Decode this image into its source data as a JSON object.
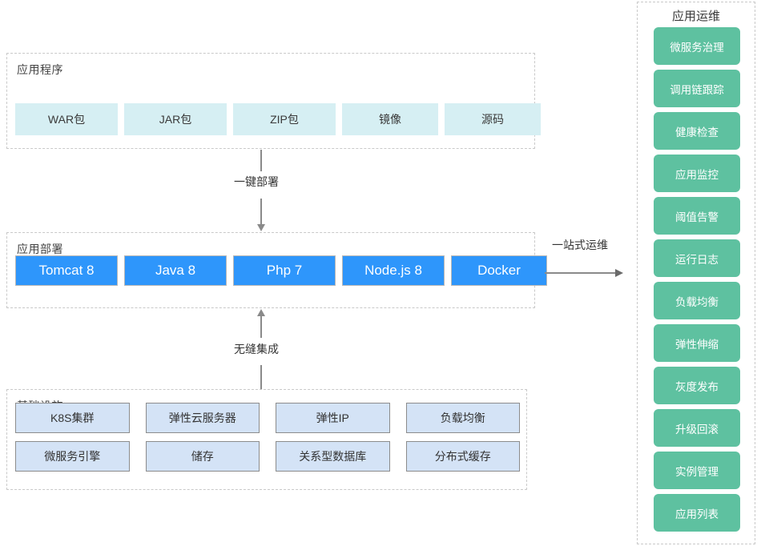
{
  "groups": {
    "application": {
      "title": "应用程序",
      "items": [
        {
          "label": "WAR包"
        },
        {
          "label": "JAR包"
        },
        {
          "label": "ZIP包"
        },
        {
          "label": "镜像"
        },
        {
          "label": "源码"
        }
      ]
    },
    "deployment": {
      "title": "应用部署",
      "items": [
        {
          "label": "Tomcat 8"
        },
        {
          "label": "Java 8"
        },
        {
          "label": "Php 7"
        },
        {
          "label": "Node.js 8"
        },
        {
          "label": "Docker"
        }
      ]
    },
    "infrastructure": {
      "title": "基础设施",
      "row1": [
        {
          "label": "K8S集群"
        },
        {
          "label": "弹性云服务器"
        },
        {
          "label": "弹性IP"
        },
        {
          "label": "负载均衡"
        }
      ],
      "row2": [
        {
          "label": "微服务引擎"
        },
        {
          "label": "储存"
        },
        {
          "label": "关系型数据库"
        },
        {
          "label": "分布式缓存"
        }
      ]
    },
    "operations": {
      "title": "应用运维",
      "items": [
        {
          "label": "微服务治理"
        },
        {
          "label": "调用链跟踪"
        },
        {
          "label": "健康检查"
        },
        {
          "label": "应用监控"
        },
        {
          "label": "阈值告警"
        },
        {
          "label": "运行日志"
        },
        {
          "label": "负载均衡"
        },
        {
          "label": "弹性伸缩"
        },
        {
          "label": "灰度发布"
        },
        {
          "label": "升级回滚"
        },
        {
          "label": "实例管理"
        },
        {
          "label": "应用列表"
        }
      ]
    }
  },
  "connectors": {
    "app_to_deploy": {
      "label": "一键部署",
      "direction": "down"
    },
    "infra_to_deploy": {
      "label": "无缝集成",
      "direction": "up"
    },
    "deploy_to_ops": {
      "label": "一站式运维",
      "direction": "right"
    }
  },
  "colors": {
    "application_chip": "#d6eff3",
    "deployment_chip": "#2e96fb",
    "infrastructure_chip": "#d4e3f6",
    "operations_chip": "#5ec1a0",
    "group_border": "#c9c9c9",
    "connector": "#8a8a8a"
  }
}
